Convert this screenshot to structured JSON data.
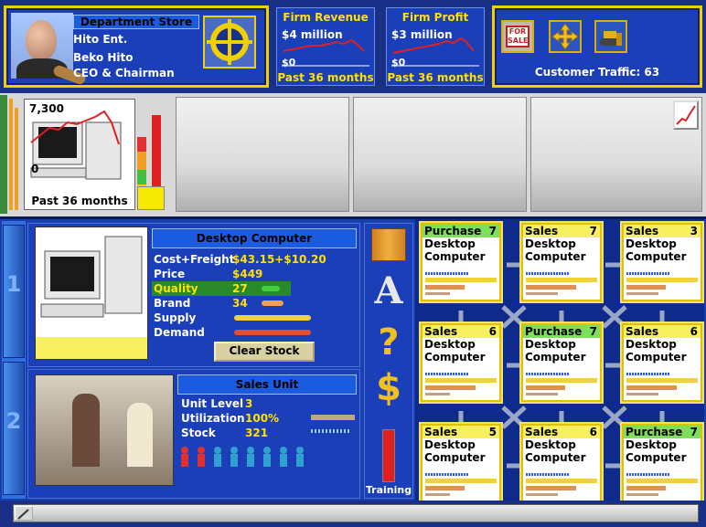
{
  "header": {
    "department_title": "Department Store",
    "firm_name": "Hito Ent.",
    "person_name": "Beko Hito",
    "person_title": "CEO & Chairman"
  },
  "revenue_panel": {
    "title": "Firm Revenue",
    "value": "$4 million",
    "zero": "$0",
    "footer": "Past 36 months"
  },
  "profit_panel": {
    "title": "Firm Profit",
    "value": "$3 million",
    "zero": "$0",
    "footer": "Past 36 months"
  },
  "tools": {
    "for_sale_label": "FOR SALE",
    "traffic": "Customer Traffic: 63"
  },
  "units_chart": {
    "max_value": "7,300",
    "min_value": "0",
    "footer": "Past 36 months"
  },
  "product": {
    "title": "Desktop Computer",
    "rows": [
      {
        "label": "Cost+Freight",
        "value": "$43.15+$10.20"
      },
      {
        "label": "Price",
        "value": "$449"
      },
      {
        "label": "Quality",
        "value": "27"
      },
      {
        "label": "Brand",
        "value": "34"
      },
      {
        "label": "Supply",
        "value": ""
      },
      {
        "label": "Demand",
        "value": ""
      }
    ],
    "clear_stock": "Clear Stock"
  },
  "sales_unit": {
    "title": "Sales Unit",
    "rows": [
      {
        "label": "Unit Level",
        "value": "3"
      },
      {
        "label": "Utilization",
        "value": "100%"
      },
      {
        "label": "Stock",
        "value": "321"
      }
    ]
  },
  "sidebar": {
    "tab1": "1",
    "tab2": "2",
    "training_label": "Training"
  },
  "blocks": [
    {
      "type": "Purchase",
      "num": "7",
      "line1": "Desktop",
      "line2": "Computer"
    },
    {
      "type": "Sales",
      "num": "7",
      "line1": "Desktop",
      "line2": "Computer"
    },
    {
      "type": "Sales",
      "num": "3",
      "line1": "Desktop",
      "line2": "Computer"
    },
    {
      "type": "Sales",
      "num": "6",
      "line1": "Desktop",
      "line2": "Computer"
    },
    {
      "type": "Purchase",
      "num": "7",
      "line1": "Desktop",
      "line2": "Computer"
    },
    {
      "type": "Sales",
      "num": "6",
      "line1": "Desktop",
      "line2": "Computer"
    },
    {
      "type": "Sales",
      "num": "5",
      "line1": "Desktop",
      "line2": "Computer"
    },
    {
      "type": "Sales",
      "num": "6",
      "line1": "Desktop",
      "line2": "Computer"
    },
    {
      "type": "Purchase",
      "num": "7",
      "line1": "Desktop",
      "line2": "Computer"
    }
  ],
  "colors": {
    "purchase_head": "#7ee05a",
    "sales_head": "#f6f060",
    "accent_yellow": "#ffe000",
    "panel_blue": "#1b3fb8"
  }
}
